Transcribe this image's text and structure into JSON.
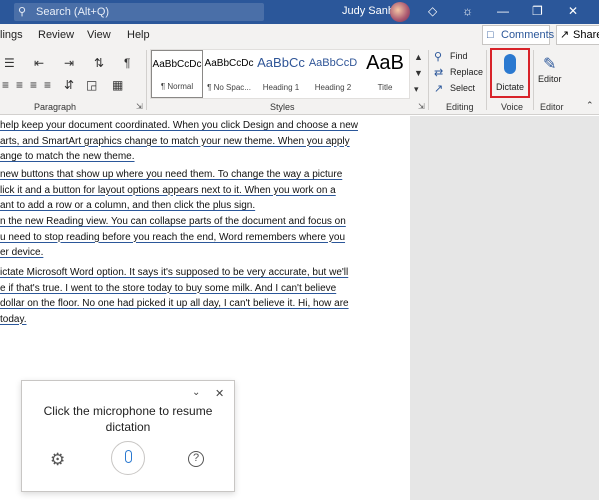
{
  "titlebar": {
    "search_placeholder": "Search (Alt+Q)",
    "user_name": "Judy Sanhz"
  },
  "menu": {
    "items": [
      "lings",
      "Review",
      "View",
      "Help"
    ]
  },
  "actions": {
    "comments": "Comments",
    "share": "Share"
  },
  "ribbon": {
    "groups": {
      "paragraph": "Paragraph",
      "styles": "Styles",
      "editing": "Editing",
      "voice": "Voice",
      "editor": "Editor"
    },
    "styles": [
      {
        "preview": "AaBbCcDc",
        "name": "¶ Normal"
      },
      {
        "preview": "AaBbCcDc",
        "name": "¶ No Spac..."
      },
      {
        "preview": "AaBbCc",
        "name": "Heading 1"
      },
      {
        "preview": "AaBbCcD",
        "name": "Heading 2"
      },
      {
        "preview": "AaB",
        "name": "Title"
      }
    ],
    "editing": {
      "find": "Find",
      "replace": "Replace",
      "select": "Select"
    },
    "dictate": "Dictate",
    "editor": "Editor"
  },
  "document": {
    "paragraphs": [
      [
        "help keep your document coordinated. When you click Design and choose a new",
        "arts, and SmartArt graphics change to match your new theme. When you apply",
        "ange to match the new theme."
      ],
      [
        "new buttons that show up where you need them. To change the way a picture",
        "lick it and a button for layout options appears next to it. When you work on a",
        "ant to add a row or a column, and then click the plus sign."
      ],
      [
        "n the new Reading view. You can collapse parts of the document and focus on",
        "u need to stop reading before you reach the end, Word remembers where you",
        "er device."
      ],
      [
        "ictate Microsoft Word option. It says it's supposed to be very accurate, but we'll",
        "e if that's true. I went to the store today to buy some milk. And I can't believe",
        "dollar on the floor. No one had picked it up all day, I can't believe it. Hi, how are",
        "today."
      ]
    ]
  },
  "dictation_panel": {
    "message": "Click the microphone to resume dictation"
  },
  "colors": {
    "titlebar": "#2b579a",
    "accent": "#2b79d0",
    "highlight": "#d8232a"
  }
}
